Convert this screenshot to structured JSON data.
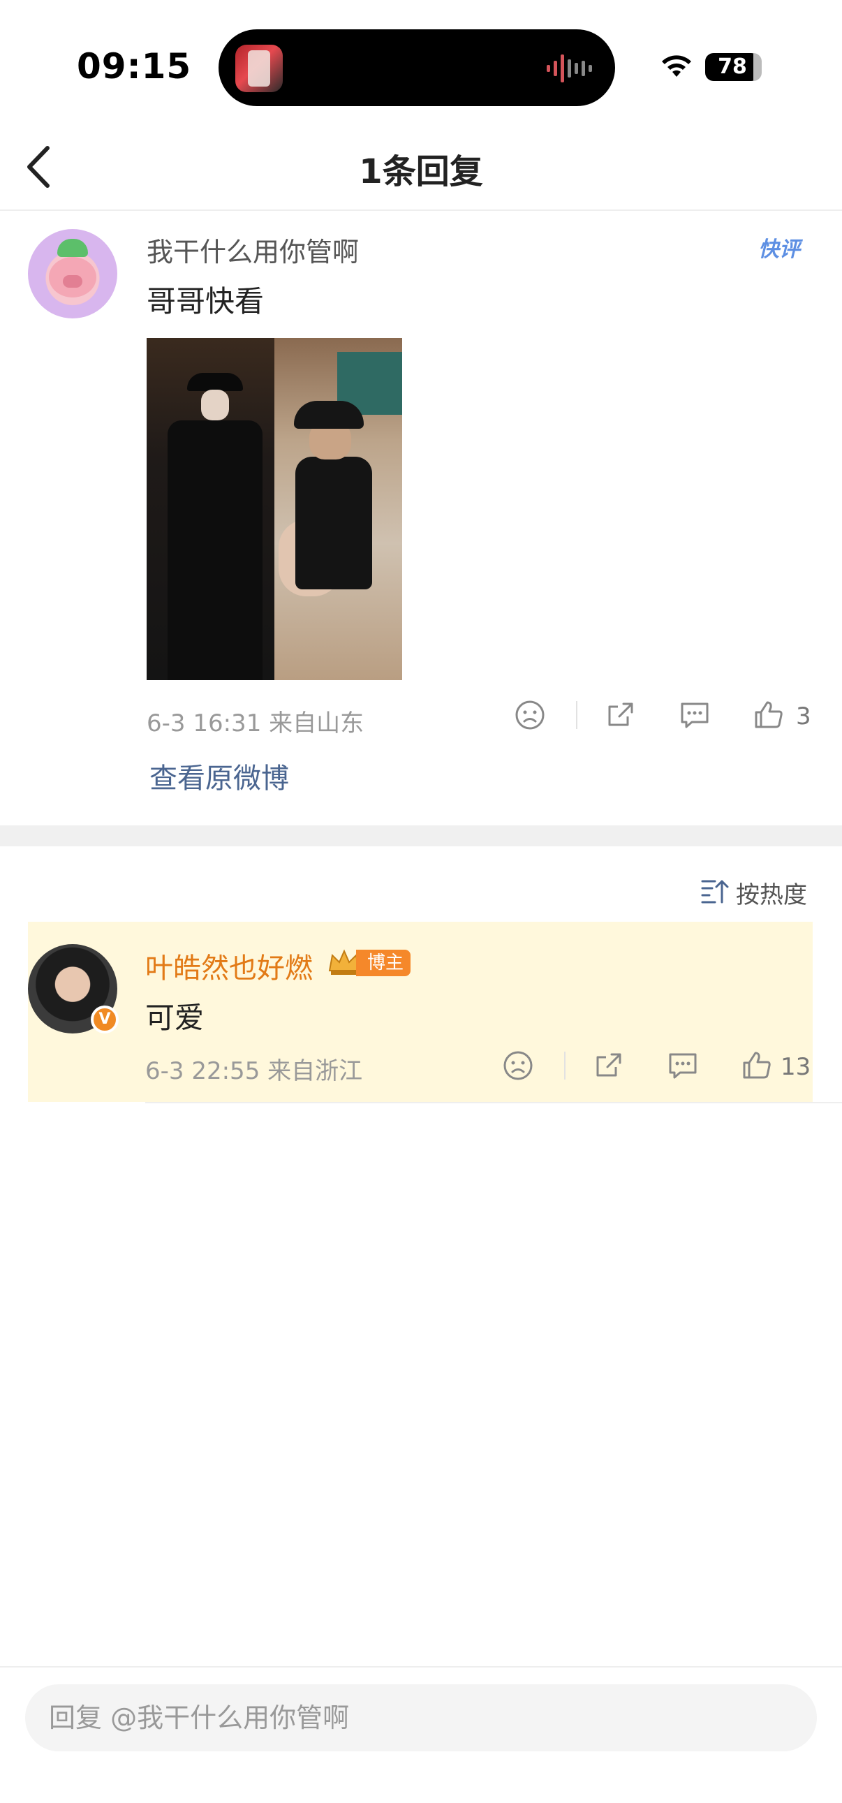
{
  "status_bar": {
    "time": "09:15",
    "battery": "78"
  },
  "nav": {
    "title": "1条回复"
  },
  "root_comment": {
    "username": "我干什么用你管啊",
    "text": "哥哥快看",
    "badge": "快评",
    "meta": "6-3 16:31  来自山东",
    "likes": "3",
    "view_original": "查看原微博"
  },
  "sort": {
    "label": "按热度"
  },
  "reply": {
    "username": "叶皓然也好燃",
    "author_badge": "博主",
    "verified": "V",
    "text": "可爱",
    "meta": "6-3 22:55  来自浙江",
    "likes": "13"
  },
  "bottom": {
    "placeholder": "回复 @我干什么用你管啊"
  },
  "colors": {
    "accent": "#e27a16",
    "link": "#4a6590",
    "highlight_bg": "#fff8dc"
  }
}
